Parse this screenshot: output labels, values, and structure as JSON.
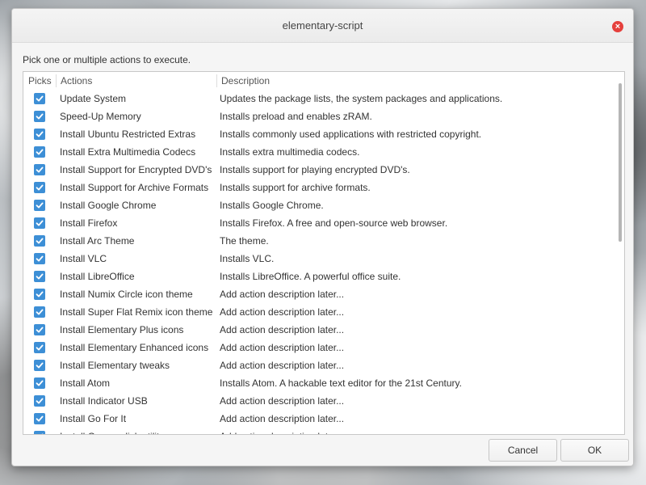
{
  "window": {
    "title": "elementary-script",
    "close_symbol": "×"
  },
  "prompt": "Pick one or multiple actions to execute.",
  "columns": {
    "picks": "Picks",
    "actions": "Actions",
    "description": "Description"
  },
  "rows": [
    {
      "action": "Update System",
      "description": "Updates the package lists, the system packages and applications.",
      "checked": true
    },
    {
      "action": "Speed-Up Memory",
      "description": "Installs preload and enables zRAM.",
      "checked": true
    },
    {
      "action": "Install Ubuntu Restricted Extras",
      "description": "Installs commonly used applications with restricted copyright.",
      "checked": true
    },
    {
      "action": "Install Extra Multimedia Codecs",
      "description": "Installs extra multimedia codecs.",
      "checked": true
    },
    {
      "action": "Install Support for Encrypted DVD's",
      "description": "Installs support for playing encrypted DVD's.",
      "checked": true
    },
    {
      "action": "Install Support for Archive Formats",
      "description": "Installs support for archive formats.",
      "checked": true
    },
    {
      "action": "Install Google Chrome",
      "description": "Installs Google Chrome.",
      "checked": true
    },
    {
      "action": "Install Firefox",
      "description": "Installs Firefox. A free and open-source web browser.",
      "checked": true
    },
    {
      "action": "Install Arc Theme",
      "description": "The theme.",
      "checked": true
    },
    {
      "action": "Install VLC",
      "description": "Installs VLC.",
      "checked": true
    },
    {
      "action": "Install LibreOffice",
      "description": "Installs LibreOffice. A powerful office suite.",
      "checked": true
    },
    {
      "action": "Install Numix Circle icon theme",
      "description": "Add action description later...",
      "checked": true
    },
    {
      "action": "Install Super Flat Remix icon theme",
      "description": "Add action description later...",
      "checked": true
    },
    {
      "action": "Install Elementary Plus icons",
      "description": "Add action description later...",
      "checked": true
    },
    {
      "action": "Install Elementary Enhanced icons",
      "description": "Add action description later...",
      "checked": true
    },
    {
      "action": "Install Elementary tweaks",
      "description": "Add action description later...",
      "checked": true
    },
    {
      "action": "Install Atom",
      "description": "Installs Atom. A hackable text editor for the 21st Century.",
      "checked": true
    },
    {
      "action": "Install Indicator USB",
      "description": "Add action description later...",
      "checked": true
    },
    {
      "action": "Install Go For It",
      "description": "Add action description later...",
      "checked": true
    },
    {
      "action": "Install Gnome disk utility",
      "description": "Add action description later...",
      "checked": true
    }
  ],
  "buttons": {
    "cancel": "Cancel",
    "ok": "OK"
  },
  "colors": {
    "checkbox": "#3d8fd6",
    "close_button": "#e5403c"
  },
  "icons": {
    "close": "close-icon",
    "check": "checkmark-icon"
  }
}
